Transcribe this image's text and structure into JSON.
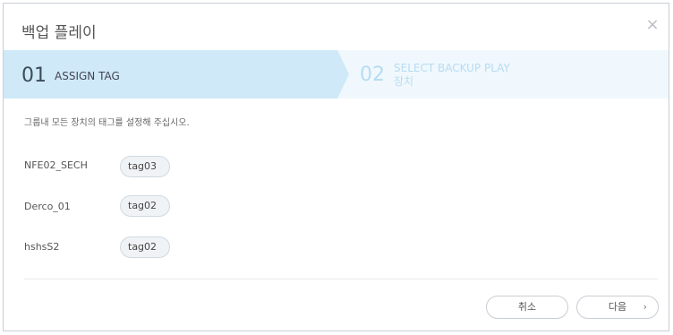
{
  "dialog": {
    "title": "백업 플레이",
    "close_icon": "×"
  },
  "steps": [
    {
      "number": "01",
      "label": "ASSIGN TAG",
      "active": true
    },
    {
      "number": "02",
      "label_line1": "SELECT BACKUP PLAY",
      "label_line2": "장치",
      "active": false
    }
  ],
  "instruction": "그룹내 모든 장치의 태그를 설정해 주십시오.",
  "devices": [
    {
      "name": "NFE02_SECH",
      "tag": "tag03"
    },
    {
      "name": "Derco_01",
      "tag": "tag02"
    },
    {
      "name": "hshsS2",
      "tag": "tag02"
    }
  ],
  "buttons": {
    "cancel": "취소",
    "next": "다음",
    "next_arrow": "›"
  },
  "colors": {
    "active_step_bg": "#cfe9f8",
    "inactive_step_text": "#b6dcf1"
  }
}
